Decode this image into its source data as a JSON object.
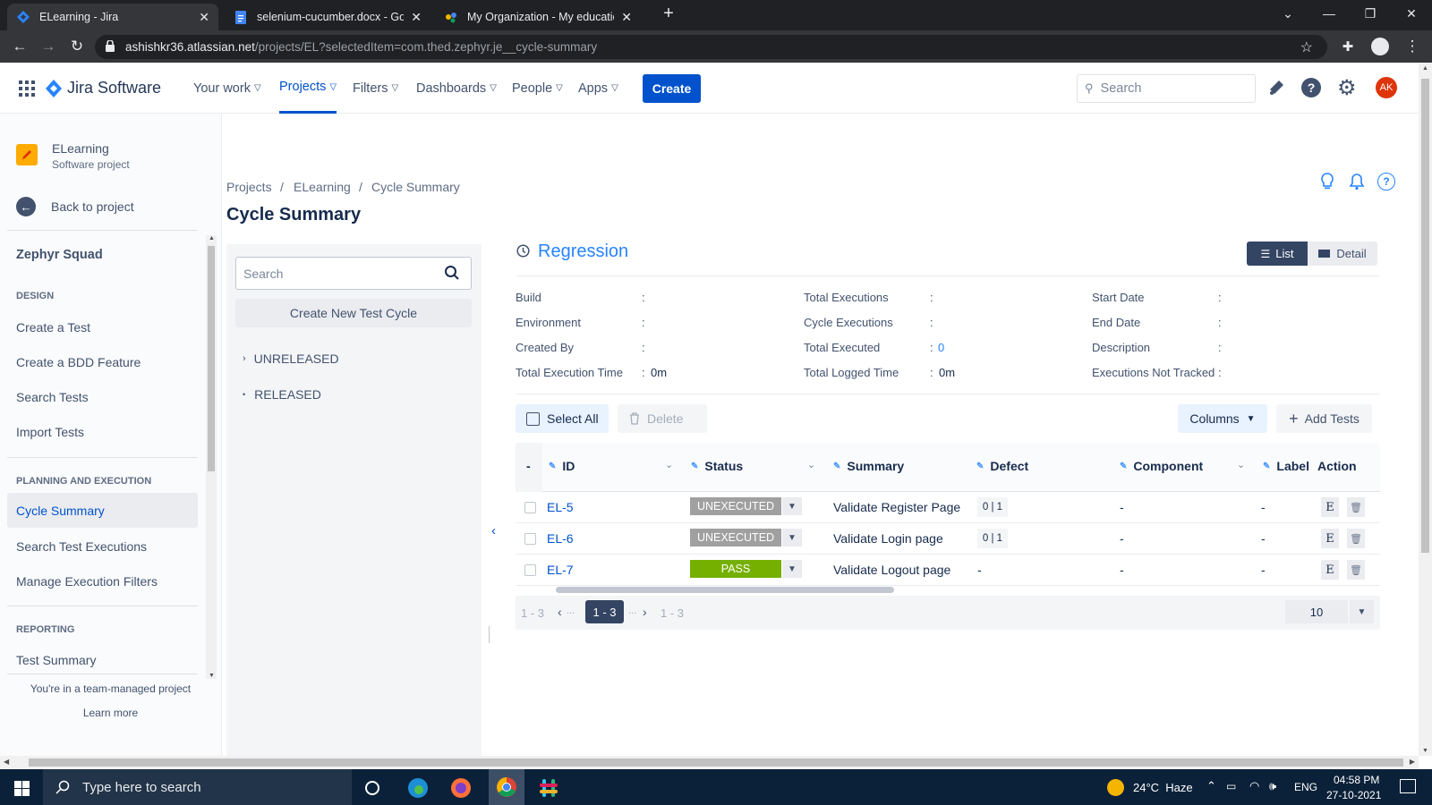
{
  "browser": {
    "tabs": [
      {
        "title": "ELearning - Jira",
        "active": true
      },
      {
        "title": "selenium-cucumber.docx - Goog",
        "active": false
      },
      {
        "title": "My Organization - My education",
        "active": false
      }
    ],
    "url_host": "ashishkr36.atlassian.net",
    "url_path": "/projects/EL?selectedItem=com.thed.zephyr.je__cycle-summary"
  },
  "topnav": {
    "product": "Jira Software",
    "items": [
      "Your work",
      "Projects",
      "Filters",
      "Dashboards",
      "People",
      "Apps"
    ],
    "create_label": "Create",
    "search_placeholder": "Search",
    "avatar_initials": "AK"
  },
  "sidebar": {
    "project_name": "ELearning",
    "project_type": "Software project",
    "back_label": "Back to project",
    "section_title": "Zephyr Squad",
    "design_heading": "DESIGN",
    "design_items": [
      "Create a Test",
      "Create a BDD Feature",
      "Search Tests",
      "Import Tests"
    ],
    "planning_heading": "PLANNING AND EXECUTION",
    "planning_items": [
      "Cycle Summary",
      "Search Test Executions",
      "Manage Execution Filters"
    ],
    "reporting_heading": "REPORTING",
    "reporting_items": [
      "Test Summary"
    ],
    "footer_text": "You're in a team-managed project",
    "footer_link": "Learn more"
  },
  "breadcrumb": [
    "Projects",
    "ELearning",
    "Cycle Summary"
  ],
  "page_title": "Cycle Summary",
  "tree": {
    "search_placeholder": "Search",
    "create_label": "Create New Test Cycle",
    "nodes": [
      "UNRELEASED",
      "RELEASED"
    ]
  },
  "cycle": {
    "name": "Regression",
    "view_list": "List",
    "view_detail": "Detail",
    "fields_col1": [
      {
        "label": "Build",
        "value": ""
      },
      {
        "label": "Environment",
        "value": ""
      },
      {
        "label": "Created By",
        "value": ""
      },
      {
        "label": "Total Execution Time",
        "value": "0m"
      }
    ],
    "fields_col2": [
      {
        "label": "Total Executions",
        "value": ""
      },
      {
        "label": "Cycle Executions",
        "value": ""
      },
      {
        "label": "Total Executed",
        "value": "0"
      },
      {
        "label": "Total Logged Time",
        "value": "0m"
      }
    ],
    "fields_col3": [
      {
        "label": "Start Date",
        "value": ""
      },
      {
        "label": "End Date",
        "value": ""
      },
      {
        "label": "Description",
        "value": ""
      },
      {
        "label": "Executions Not Tracked",
        "value": ""
      }
    ],
    "select_all": "Select All",
    "delete": "Delete",
    "columns_btn": "Columns",
    "add_tests": "Add Tests"
  },
  "table": {
    "headers": [
      "ID",
      "Status",
      "Summary",
      "Defect",
      "Component",
      "Label",
      "Action"
    ],
    "header_dash": "-",
    "rows": [
      {
        "id": "EL-5",
        "status": "UNEXECUTED",
        "status_color": "#a0a0a0",
        "summary": "Validate Register Page",
        "defect": "0 | 1",
        "component": "-",
        "label": "-",
        "action": "E"
      },
      {
        "id": "EL-6",
        "status": "UNEXECUTED",
        "status_color": "#a0a0a0",
        "summary": "Validate Login page",
        "defect": "0 | 1",
        "component": "-",
        "label": "-",
        "action": "E"
      },
      {
        "id": "EL-7",
        "status": "PASS",
        "status_color": "#75b000",
        "summary": "Validate Logout page",
        "defect": "-",
        "component": "-",
        "label": "-",
        "action": "E"
      }
    ]
  },
  "pagination": {
    "range_left": "1 - 3",
    "ellipsis": "...",
    "current": "1 - 3",
    "range_right": "1 - 3",
    "page_size": "10"
  },
  "taskbar": {
    "search_placeholder": "Type here to search",
    "weather": "24°C  Haze",
    "lang": "ENG",
    "time": "04:58 PM",
    "date": "27-10-2021"
  }
}
